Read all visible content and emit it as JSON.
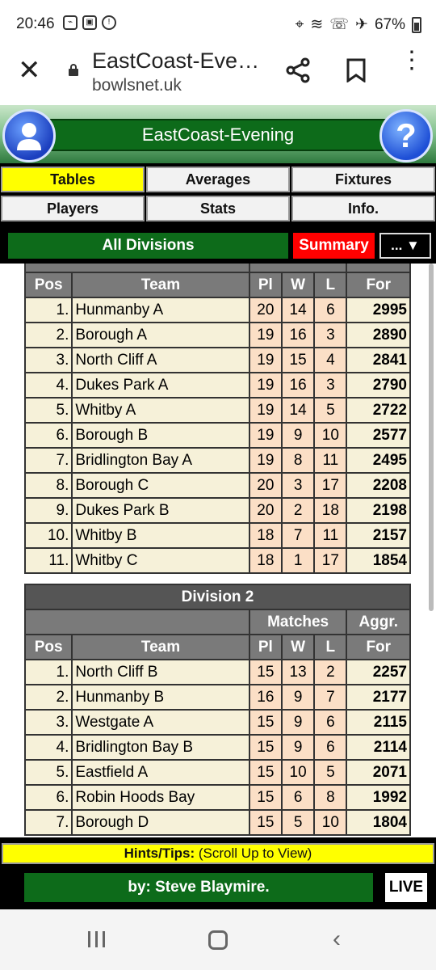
{
  "status_bar": {
    "time": "20:46",
    "battery": "67%"
  },
  "browser": {
    "page_title": "EastCoast-Eve…",
    "domain": "bowlsnet.uk"
  },
  "site": {
    "header_title": "EastCoast-Evening",
    "help_label": "?",
    "nav": [
      "Tables",
      "Averages",
      "Fixtures",
      "Players",
      "Stats",
      "Info."
    ],
    "division_selector": "All Divisions",
    "summary_label": "Summary",
    "more_label": "... ▼",
    "hints_label": "Hints/Tips:",
    "hints_text": " (Scroll Up to View)",
    "credit": "by: Steve Blaymire.",
    "live_label": "LIVE"
  },
  "table1": {
    "columns": [
      "Pos",
      "Team",
      "Pl",
      "W",
      "L",
      "For"
    ],
    "rows": [
      [
        "1.",
        "Hunmanby A",
        "20",
        "14",
        "6",
        "2995"
      ],
      [
        "2.",
        "Borough A",
        "19",
        "16",
        "3",
        "2890"
      ],
      [
        "3.",
        "North Cliff A",
        "19",
        "15",
        "4",
        "2841"
      ],
      [
        "4.",
        "Dukes Park A",
        "19",
        "16",
        "3",
        "2790"
      ],
      [
        "5.",
        "Whitby A",
        "19",
        "14",
        "5",
        "2722"
      ],
      [
        "6.",
        "Borough B",
        "19",
        "9",
        "10",
        "2577"
      ],
      [
        "7.",
        "Bridlington Bay A",
        "19",
        "8",
        "11",
        "2495"
      ],
      [
        "8.",
        "Borough C",
        "20",
        "3",
        "17",
        "2208"
      ],
      [
        "9.",
        "Dukes Park B",
        "20",
        "2",
        "18",
        "2198"
      ],
      [
        "10.",
        "Whitby B",
        "18",
        "7",
        "11",
        "2157"
      ],
      [
        "11.",
        "Whitby C",
        "18",
        "1",
        "17",
        "1854"
      ]
    ]
  },
  "table2": {
    "title": "Division 2",
    "group_headers": [
      "Matches",
      "Aggr."
    ],
    "columns": [
      "Pos",
      "Team",
      "Pl",
      "W",
      "L",
      "For"
    ],
    "rows": [
      [
        "1.",
        "North Cliff B",
        "15",
        "13",
        "2",
        "2257"
      ],
      [
        "2.",
        "Hunmanby B",
        "16",
        "9",
        "7",
        "2177"
      ],
      [
        "3.",
        "Westgate A",
        "15",
        "9",
        "6",
        "2115"
      ],
      [
        "4.",
        "Bridlington Bay B",
        "15",
        "9",
        "6",
        "2114"
      ],
      [
        "5.",
        "Eastfield A",
        "15",
        "10",
        "5",
        "2071"
      ],
      [
        "6.",
        "Robin Hoods Bay",
        "15",
        "6",
        "8",
        "1992"
      ],
      [
        "7.",
        "Borough D",
        "15",
        "5",
        "10",
        "1804"
      ]
    ]
  }
}
